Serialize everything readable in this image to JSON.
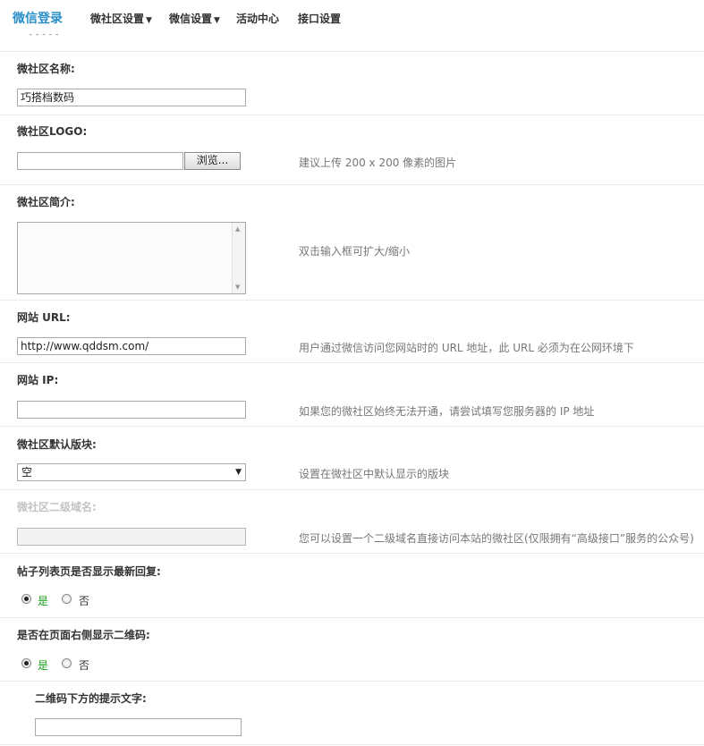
{
  "topbar": {
    "brand": "微信登录",
    "nav": [
      {
        "label": "微社区设置",
        "caret": "▼"
      },
      {
        "label": "微信设置",
        "caret": "▼"
      },
      {
        "label": "活动中心"
      },
      {
        "label": "接口设置"
      }
    ]
  },
  "form": {
    "name": {
      "label": "微社区名称:",
      "value": "巧搭档数码"
    },
    "logo": {
      "label": "微社区LOGO:",
      "value": "",
      "button": "浏览...",
      "tip": "建议上传  200 x 200 像素的图片"
    },
    "intro": {
      "label": "微社区简介:",
      "value": "",
      "tip": "双击输入框可扩大/缩小"
    },
    "url": {
      "label": "网站  URL:",
      "value": "http://www.qddsm.com/",
      "tip": "用户通过微信访问您网站时的  URL 地址，此  URL 必须为在公网环境下"
    },
    "ip": {
      "label": "网站  IP:",
      "value": "",
      "tip": "如果您的微社区始终无法开通，请尝试填写您服务器的  IP 地址"
    },
    "default_board": {
      "label": "微社区默认版块:",
      "value": "空",
      "tip": "设置在微社区中默认显示的版块"
    },
    "subdomain": {
      "label": "微社区二级域名:",
      "value": "",
      "tip": "您可以设置一个二级域名直接访问本站的微社区(仅限拥有“高级接口”服务的公众号)"
    },
    "show_latest_reply": {
      "label": "帖子列表页是否显示最新回复:",
      "yes": "是",
      "no": "否",
      "selected": "是"
    },
    "show_qrcode": {
      "label": "是否在页面右侧显示二维码:",
      "yes": "是",
      "no": "否",
      "selected": "是"
    },
    "qrcode_tip": {
      "label": "二维码下方的提示文字:",
      "value": ""
    }
  }
}
